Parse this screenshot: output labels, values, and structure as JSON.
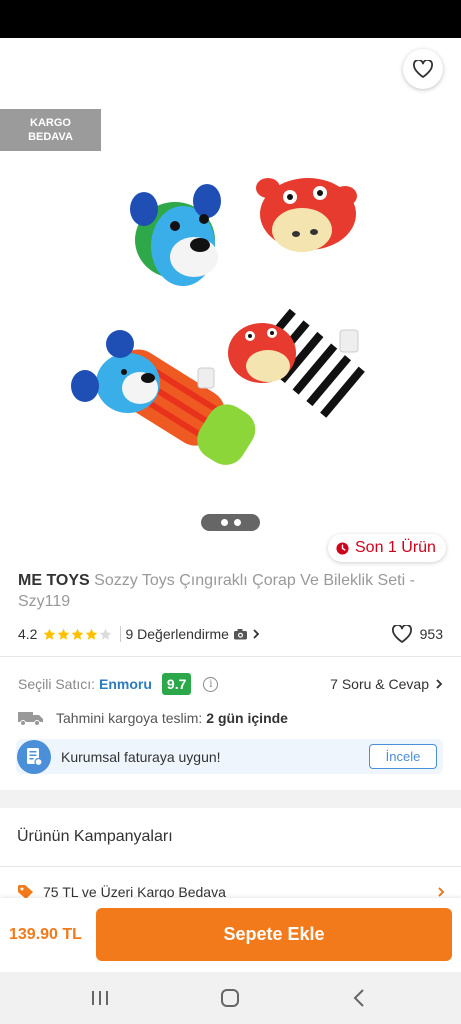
{
  "badge": {
    "line1": "KARGO",
    "line2": "BEDAVA"
  },
  "stock": {
    "label": "Son 1 Ürün"
  },
  "product": {
    "brand": "ME TOYS",
    "name": "Sozzy Toys Çıngıraklı Çorap Ve Bileklik Seti - Szy119",
    "rating": "4.2",
    "stars_filled": 4,
    "stars_total": 5,
    "reviews_label": "9 Değerlendirme",
    "likes": "953"
  },
  "seller": {
    "label": "Seçili Satıcı:",
    "name": "Enmoru",
    "score": "9.7",
    "qa_label": "7 Soru & Cevap"
  },
  "delivery": {
    "label": "Tahmini kargoya teslim:",
    "value": "2 gün içinde"
  },
  "invoice": {
    "text": "Kurumsal faturaya uygun!",
    "button": "İncele"
  },
  "campaigns": {
    "title": "Ürünün Kampanyaları",
    "items": [
      {
        "label": "75 TL ve Üzeri Kargo Bedava"
      }
    ]
  },
  "cart": {
    "price": "139.90 TL",
    "button": "Sepete Ekle"
  },
  "colors": {
    "accent": "#f27a1a",
    "link": "#2c7cc1",
    "score": "#2ba84a",
    "stock": "#d0021b"
  },
  "icons": [
    "back-arrow-icon",
    "share-icon",
    "heart-icon",
    "clock-icon",
    "star-icon",
    "camera-icon",
    "chevron-right-icon",
    "info-icon",
    "truck-icon",
    "invoice-icon",
    "tag-icon",
    "recent-apps-icon",
    "home-icon",
    "back-nav-icon"
  ]
}
